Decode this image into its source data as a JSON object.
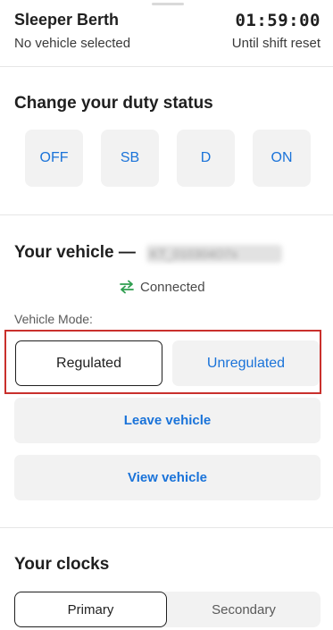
{
  "header": {
    "status_title": "Sleeper Berth",
    "vehicle_subtitle": "No vehicle selected",
    "clock_value": "01:59:00",
    "clock_subtitle": "Until shift reset"
  },
  "duty": {
    "title": "Change your duty status",
    "buttons": [
      "OFF",
      "SB",
      "D",
      "ON"
    ]
  },
  "vehicle": {
    "title": "Your vehicle —",
    "name_blurred": "KT_010304O7x",
    "connection_status": "Connected",
    "mode_label": "Vehicle Mode:",
    "modes": {
      "regulated": "Regulated",
      "unregulated": "Unregulated",
      "selected": "Regulated"
    },
    "leave_label": "Leave vehicle",
    "view_label": "View vehicle"
  },
  "clocks": {
    "title": "Your clocks",
    "tabs": [
      "Primary",
      "Secondary"
    ],
    "active_tab": "Primary"
  },
  "colors": {
    "accent": "#1a73d9",
    "connected_green": "#2e9e4f",
    "highlight_red": "#c9302c"
  }
}
